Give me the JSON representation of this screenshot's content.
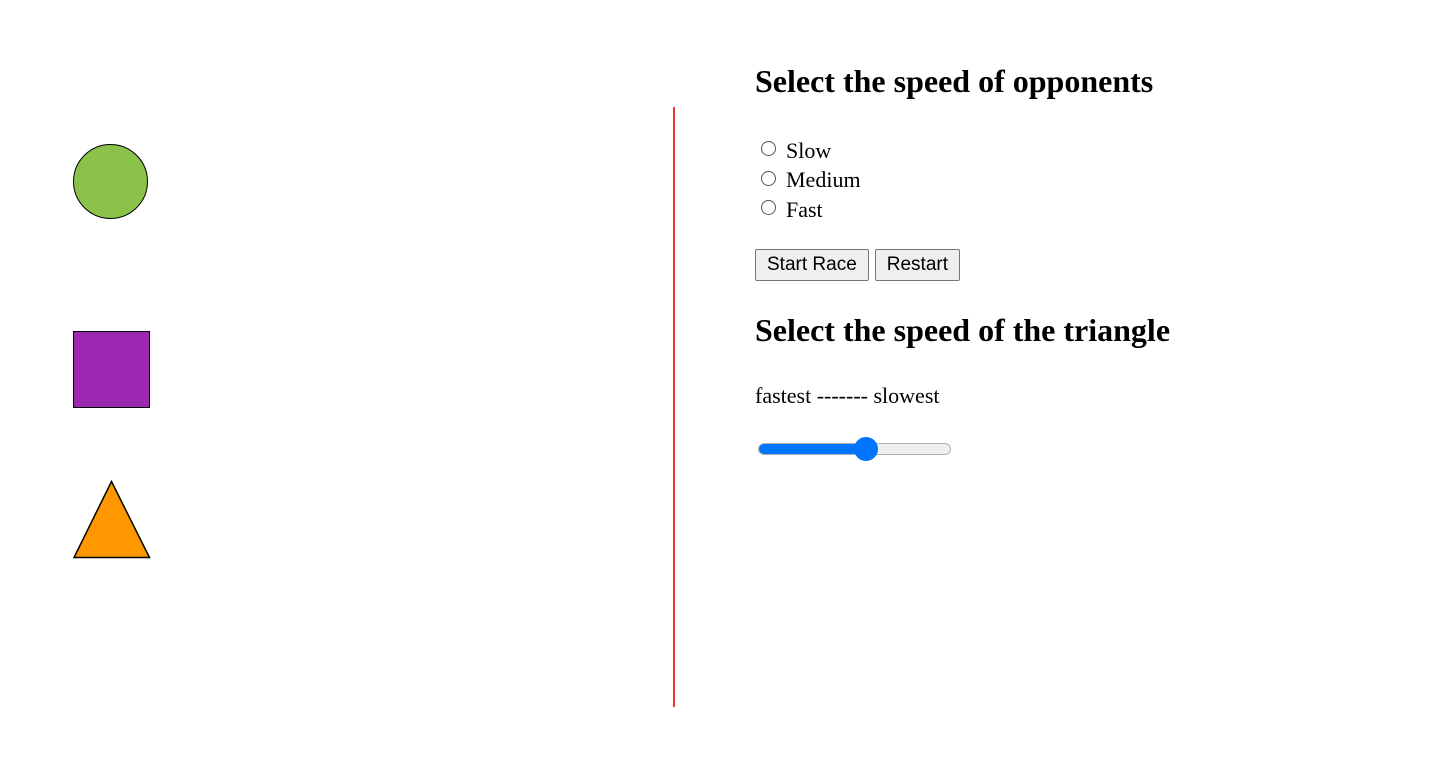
{
  "colors": {
    "circle": "#8bc34a",
    "square": "#9c27b0",
    "triangle": "#ff9800",
    "finish_line": "#e53935",
    "accent": "#0075ff"
  },
  "racers": {
    "circle_icon": "circle-shape",
    "square_icon": "square-shape",
    "triangle_icon": "triangle-shape"
  },
  "opponents": {
    "heading": "Select the speed of opponents",
    "options": [
      {
        "label": "Slow",
        "checked": false
      },
      {
        "label": "Medium",
        "checked": false
      },
      {
        "label": "Fast",
        "checked": false
      }
    ]
  },
  "actions": {
    "start_label": "Start Race",
    "restart_label": "Restart"
  },
  "triangle_speed": {
    "heading": "Select the speed of the triangle",
    "scale_label": "fastest ------- slowest",
    "slider_value": 0.57
  }
}
